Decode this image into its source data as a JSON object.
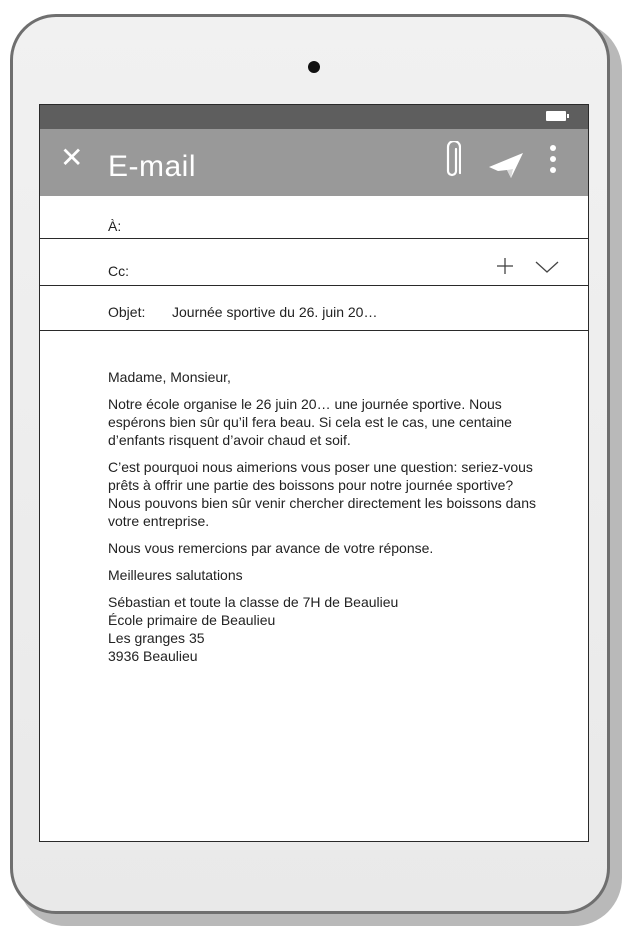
{
  "app_bar": {
    "close_icon": "close-icon",
    "title": "E-mail",
    "attach_icon": "paperclip-icon",
    "send_icon": "send-icon",
    "menu_icon": "more-vertical-icon"
  },
  "status_bar": {
    "battery_icon": "battery-icon"
  },
  "fields": {
    "to_label": "À:",
    "to_value": "",
    "cc_label": "Cc:",
    "subject_label": "Objet:",
    "subject_value": "Journée sportive du 26. juin 20…"
  },
  "body": {
    "greeting": "Madame, Monsieur,",
    "paragraph1": "Notre école organise le 26 juin 20… une journée sportive. Nous espérons bien sûr qu’il fera beau. Si cela est le cas, une centaine d’enfants risquent d’avoir chaud et soif.",
    "paragraph2": "C’est pourquoi nous aimerions vous poser une question: seriez-vous prêts à offrir une partie des boissons pour notre journée sportive? Nous pouvons bien sûr venir chercher directement les boissons dans votre entreprise.",
    "paragraph3": "Nous vous remercions par avance de votre réponse.",
    "closing": "Meilleures salutations",
    "signature": [
      "Sébastian et toute la classe de 7H de Beaulieu",
      "École primaire de Beaulieu",
      "Les granges 35",
      "3936 Beaulieu"
    ]
  }
}
